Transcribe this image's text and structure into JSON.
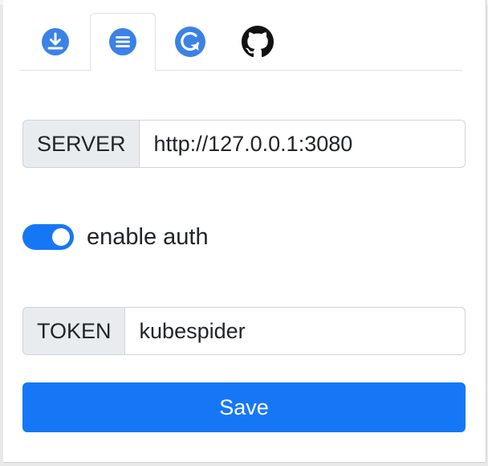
{
  "tabs": [
    {
      "icon": "download-icon",
      "active": false
    },
    {
      "icon": "list-icon",
      "active": true
    },
    {
      "icon": "refresh-icon",
      "active": false
    },
    {
      "icon": "github-icon",
      "active": false
    }
  ],
  "colors": {
    "accent": "#1677f6",
    "prefix_bg": "#e9ecef",
    "border": "#ced4da"
  },
  "server": {
    "label": "SERVER",
    "value": "http://127.0.0.1:3080"
  },
  "auth": {
    "label": "enable auth",
    "enabled": true
  },
  "token": {
    "label": "TOKEN",
    "value": "kubespider"
  },
  "save_label": "Save"
}
